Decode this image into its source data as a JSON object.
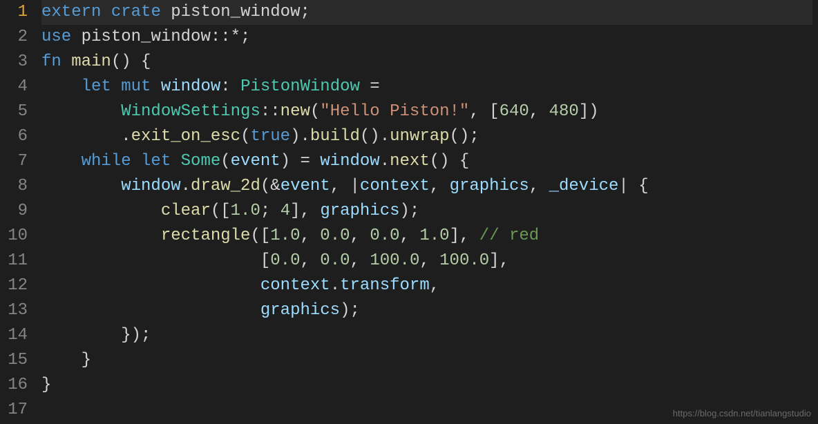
{
  "watermark": "https://blog.csdn.net/tianlangstudio",
  "lineNumbers": [
    "1",
    "2",
    "3",
    "4",
    "5",
    "6",
    "7",
    "8",
    "9",
    "10",
    "11",
    "12",
    "13",
    "14",
    "15",
    "16",
    "17"
  ],
  "activeLine": 1,
  "code": {
    "l1": {
      "kw1": "extern",
      "kw2": "crate",
      "ident": " piston_window",
      "end": ";"
    },
    "l2": {
      "kw": "use",
      "path": " piston_window::*;"
    },
    "l3": {
      "kw": "fn",
      "name": " main",
      "rest": "() {"
    },
    "l4": {
      "indent": "    ",
      "kw1": "let",
      "kw2": " mut",
      "var": " window",
      "colon": ": ",
      "type": "PistonWindow",
      "eq": " ="
    },
    "l5": {
      "indent": "        ",
      "type": "WindowSettings",
      "sep": "::",
      "fn": "new",
      "open": "(",
      "str": "\"Hello Piston!\"",
      "comma": ", [",
      "n1": "640",
      "c2": ", ",
      "n2": "480",
      "close": "])"
    },
    "l6": {
      "indent": "        .",
      "fn1": "exit_on_esc",
      "p1": "(",
      "kw": "true",
      "p2": ").",
      "fn2": "build",
      "p3": "().",
      "fn3": "unwrap",
      "p4": "();"
    },
    "l7": {
      "indent": "    ",
      "kw1": "while",
      "kw2": " let",
      "some": " Some",
      "open": "(",
      "var": "event",
      "close": ") = ",
      "obj": "window",
      "dot": ".",
      "fn": "next",
      "end": "() {"
    },
    "l8": {
      "indent": "        ",
      "obj": "window",
      "dot": ".",
      "fn": "draw_2d",
      "open": "(&",
      "var1": "event",
      "c1": ", |",
      "var2": "context",
      "c2": ", ",
      "var3": "graphics",
      "c3": ", ",
      "var4": "_device",
      "end": "| {"
    },
    "l9": {
      "indent": "            ",
      "fn": "clear",
      "open": "([",
      "n1": "1.0",
      "sep": "; ",
      "n2": "4",
      "c1": "], ",
      "var": "graphics",
      "end": ");"
    },
    "l10": {
      "indent": "            ",
      "fn": "rectangle",
      "open": "([",
      "n1": "1.0",
      "c1": ", ",
      "n2": "0.0",
      "c2": ", ",
      "n3": "0.0",
      "c3": ", ",
      "n4": "1.0",
      "close": "], ",
      "comment": "// red"
    },
    "l11": {
      "indent": "                      [",
      "n1": "0.0",
      "c1": ", ",
      "n2": "0.0",
      "c2": ", ",
      "n3": "100.0",
      "c3": ", ",
      "n4": "100.0",
      "end": "],"
    },
    "l12": {
      "indent": "                      ",
      "var": "context",
      "dot": ".",
      "prop": "transform",
      "end": ","
    },
    "l13": {
      "indent": "                      ",
      "var": "graphics",
      "end": ");"
    },
    "l14": {
      "text": "        });"
    },
    "l15": {
      "text": "    }"
    },
    "l16": {
      "text": "}"
    },
    "l17": {
      "text": ""
    }
  }
}
